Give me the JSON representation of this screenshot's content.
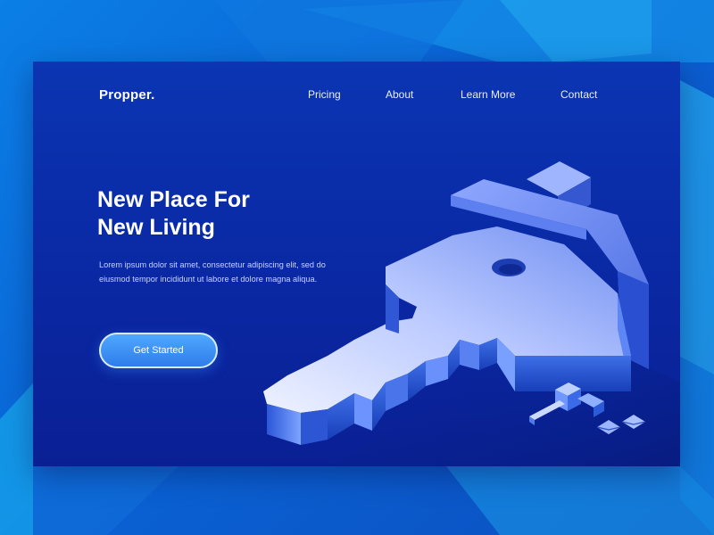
{
  "brand": {
    "name": "Propper."
  },
  "nav": {
    "items": [
      {
        "label": "Pricing"
      },
      {
        "label": "About"
      },
      {
        "label": "Learn More"
      },
      {
        "label": "Contact"
      }
    ]
  },
  "hero": {
    "title_line1": "New Place For",
    "title_line2": "New Living",
    "description": "Lorem ipsum dolor sit amet, consectetur adipiscing elit, sed do eiusmod tempor incididunt ut labore et dolore magna aliqua.",
    "cta_label": "Get Started"
  },
  "illustration": {
    "subject": "isometric house-shaped key with small key and envelopes"
  },
  "colors": {
    "backdrop": "#0a62d4",
    "card": "#0a2aa6",
    "accent": "#3f93f6",
    "key_light": "#dfe7ff"
  }
}
